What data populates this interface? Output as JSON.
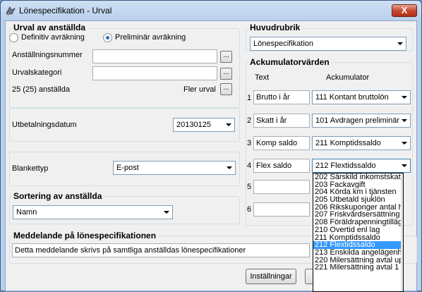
{
  "window": {
    "title": "Lönespecifikation - Urval",
    "close_label": "X"
  },
  "urval": {
    "title": "Urval av anställda",
    "radio_definitiv": "Definitiv avräkning",
    "radio_preliminar": "Preliminär avräkning",
    "selected": "Preliminär avräkning",
    "anstallningsnummer_label": "Anställningsnummer",
    "anstallningsnummer_value": "",
    "urvalskategori_label": "Urvalskategori",
    "urvalskategori_value": "",
    "count_text": "25 (25) anställda",
    "fler_urval_label": "Fler urval",
    "dots_label": "..."
  },
  "utbetalning": {
    "label": "Utbetalningsdatum",
    "value": "20130125"
  },
  "blankett": {
    "label": "Blankettyp",
    "value": "E-post"
  },
  "sortering": {
    "title": "Sortering av anställda",
    "value": "Namn"
  },
  "meddelande": {
    "title": "Meddelande på lönespecifikationen",
    "value": "Detta meddelande skrivs på samtliga anställdas lönespecifikationer"
  },
  "huvudrubrik": {
    "title": "Huvudrubrik",
    "value": "Lönespecifikation"
  },
  "ackumulator": {
    "title": "Ackumulatorvärden",
    "col_text": "Text",
    "col_ack": "Ackumulator",
    "rows": [
      {
        "num": "1",
        "text": "Brutto i år",
        "ack": "111 Kontant bruttolön"
      },
      {
        "num": "2",
        "text": "Skatt i år",
        "ack": "101 Avdragen preliminär"
      },
      {
        "num": "3",
        "text": "Komp saldo",
        "ack": "211 Komptidssaldo"
      },
      {
        "num": "4",
        "text": "Flex saldo",
        "ack": "212 Flextidssaldo"
      },
      {
        "num": "5",
        "text": "",
        "ack": ""
      },
      {
        "num": "6",
        "text": "",
        "ack": ""
      }
    ]
  },
  "dropdown_items": [
    "202 Särskild inkomstskatt",
    "203 Fackavgift",
    "204 Körda km i tjänsten",
    "205 Utbetald sjuklön",
    "206 Rikskuponger antal h",
    "207 Friskvårdsersättning",
    "208 Föräldrapenningtillägg",
    "210 Övertid enl lag",
    "211 Komptidssaldo",
    "212 Flextidssaldo",
    "213 Enskilda angelägenh",
    "220 Milersättning avtal up",
    "221 Milersättning avtal 1"
  ],
  "dropdown_selected": "212 Flextidssaldo",
  "buttons": {
    "installningar": "Inställningar",
    "second": ""
  }
}
